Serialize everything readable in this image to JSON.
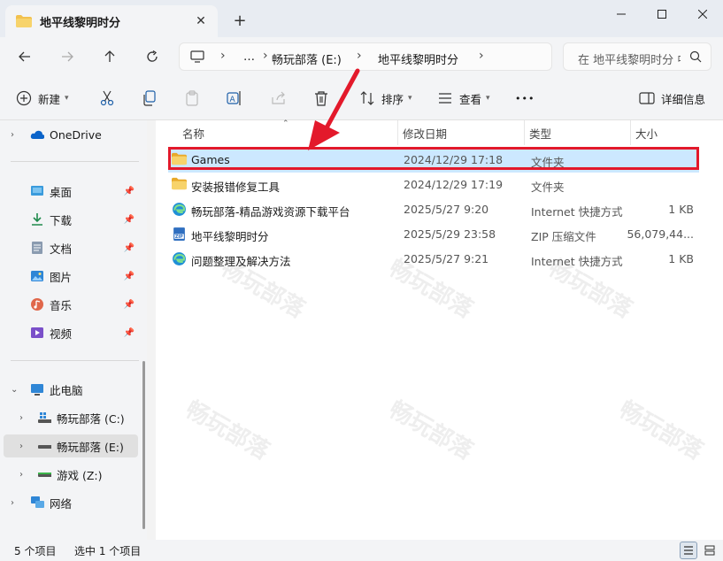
{
  "window": {
    "tab_title": "地平线黎明时分",
    "new_tab_symbol": "+",
    "close_tab_symbol": "✕"
  },
  "address": {
    "more": "…",
    "crumbs": [
      "畅玩部落 (E:)",
      "地平线黎明时分"
    ],
    "search_placeholder": "在 地平线黎明时分 中搜索"
  },
  "toolbar": {
    "new_label": "新建",
    "sort_label": "排序",
    "view_label": "查看",
    "more": "•••",
    "details_label": "详细信息"
  },
  "sidebar": {
    "onedrive": "OneDrive",
    "quick": [
      {
        "label": "桌面",
        "icon": "desktop-icon"
      },
      {
        "label": "下载",
        "icon": "download-icon"
      },
      {
        "label": "文档",
        "icon": "document-icon"
      },
      {
        "label": "图片",
        "icon": "pictures-icon"
      },
      {
        "label": "音乐",
        "icon": "music-icon"
      },
      {
        "label": "视频",
        "icon": "video-icon"
      }
    ],
    "this_pc": "此电脑",
    "drives": [
      "畅玩部落 (C:)",
      "畅玩部落 (E:)",
      "游戏 (Z:)"
    ],
    "network": "网络"
  },
  "columns": {
    "name": "名称",
    "date": "修改日期",
    "type": "类型",
    "size": "大小"
  },
  "files": [
    {
      "name": "Games",
      "date": "2024/12/29 17:18",
      "type": "文件夹",
      "size": "",
      "icon": "folder-icon",
      "selected": true
    },
    {
      "name": "安装报错修复工具",
      "date": "2024/12/29 17:19",
      "type": "文件夹",
      "size": "",
      "icon": "folder-icon",
      "selected": false
    },
    {
      "name": "畅玩部落-精品游戏资源下载平台",
      "date": "2025/5/27 9:20",
      "type": "Internet 快捷方式",
      "size": "1 KB",
      "icon": "edge-icon",
      "selected": false
    },
    {
      "name": "地平线黎明时分",
      "date": "2025/5/29 23:58",
      "type": "ZIP 压缩文件",
      "size": "56,079,44...",
      "icon": "zip-icon",
      "selected": false
    },
    {
      "name": "问题整理及解决方法",
      "date": "2025/5/27 9:21",
      "type": "Internet 快捷方式",
      "size": "1 KB",
      "icon": "edge-icon",
      "selected": false
    }
  ],
  "status": {
    "count": "5 个项目",
    "selected": "选中 1 个项目"
  },
  "colors": {
    "accent": "#0067c0",
    "selection": "#cce8ff",
    "highlight_box": "#e3192b",
    "arrow": "#e3192b",
    "folder": "#f2c14e"
  }
}
